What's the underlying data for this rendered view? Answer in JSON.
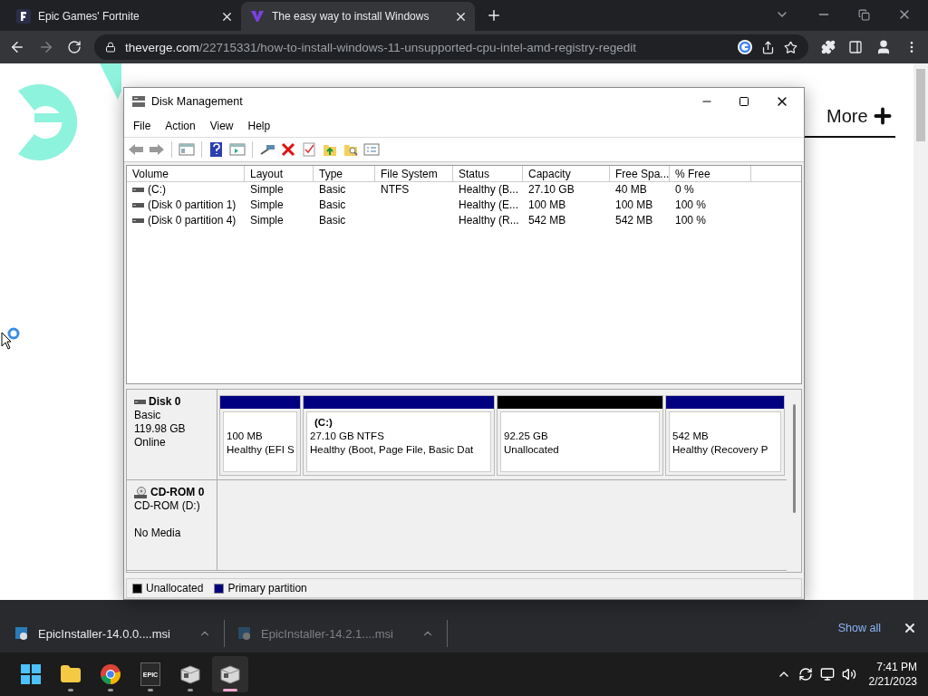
{
  "browser": {
    "tabs": [
      {
        "title": "Epic Games' Fortnite",
        "selected": false
      },
      {
        "title": "The easy way to install Windows",
        "selected": true
      }
    ],
    "address": {
      "domain": "theverge.com",
      "path": "/22715331/how-to-install-windows-11-unsupported-cpu-intel-amd-registry-regedit"
    },
    "page": {
      "more_label": "More"
    },
    "downloads": {
      "items": [
        {
          "name": "EpicInstaller-14.0.0....msi",
          "dimmed": false
        },
        {
          "name": "EpicInstaller-14.2.1....msi",
          "dimmed": true
        }
      ],
      "show_all": "Show all"
    }
  },
  "window": {
    "title": "Disk Management",
    "menu": [
      "File",
      "Action",
      "View",
      "Help"
    ],
    "table": {
      "columns": [
        "Volume",
        "Layout",
        "Type",
        "File System",
        "Status",
        "Capacity",
        "Free Spa...",
        "% Free"
      ],
      "rows": [
        [
          "(C:)",
          "Simple",
          "Basic",
          "NTFS",
          "Healthy (B...",
          "27.10 GB",
          "40 MB",
          "0 %"
        ],
        [
          "(Disk 0 partition 1)",
          "Simple",
          "Basic",
          "",
          "Healthy (E...",
          "100 MB",
          "100 MB",
          "100 %"
        ],
        [
          "(Disk 0 partition 4)",
          "Simple",
          "Basic",
          "",
          "Healthy (R...",
          "542 MB",
          "542 MB",
          "100 %"
        ]
      ]
    },
    "disks": [
      {
        "kind": "disk",
        "name": "Disk 0",
        "lines": [
          "Basic",
          "119.98 GB"
        ],
        "state": "Online",
        "partitions": [
          {
            "size": "100 MB",
            "status": "Healthy (EFI S",
            "color": "#000080"
          },
          {
            "label": "(C:)",
            "size": "27.10 GB NTFS",
            "status": "Healthy (Boot, Page File, Basic Dat",
            "color": "#000080"
          },
          {
            "size": "92.25 GB",
            "status": "Unallocated",
            "color": "#000000"
          },
          {
            "size": "542 MB",
            "status": "Healthy (Recovery P",
            "color": "#000080"
          }
        ]
      },
      {
        "kind": "cdrom",
        "name": "CD-ROM 0",
        "lines": [
          "CD-ROM (D:)"
        ],
        "state": "No Media"
      }
    ],
    "legend": [
      {
        "label": "Unallocated",
        "color": "#000000"
      },
      {
        "label": "Primary partition",
        "color": "#000080"
      }
    ]
  },
  "taskbar": {
    "apps": [
      {
        "kind": "start",
        "active": false
      },
      {
        "kind": "folder",
        "active": false
      },
      {
        "kind": "chrome",
        "active": false
      },
      {
        "kind": "epic",
        "active": false
      },
      {
        "kind": "installer",
        "active": false
      },
      {
        "kind": "installer",
        "active": true
      }
    ],
    "epic_label": "EPIC",
    "time": "7:41 PM",
    "date": "2/21/2023"
  }
}
